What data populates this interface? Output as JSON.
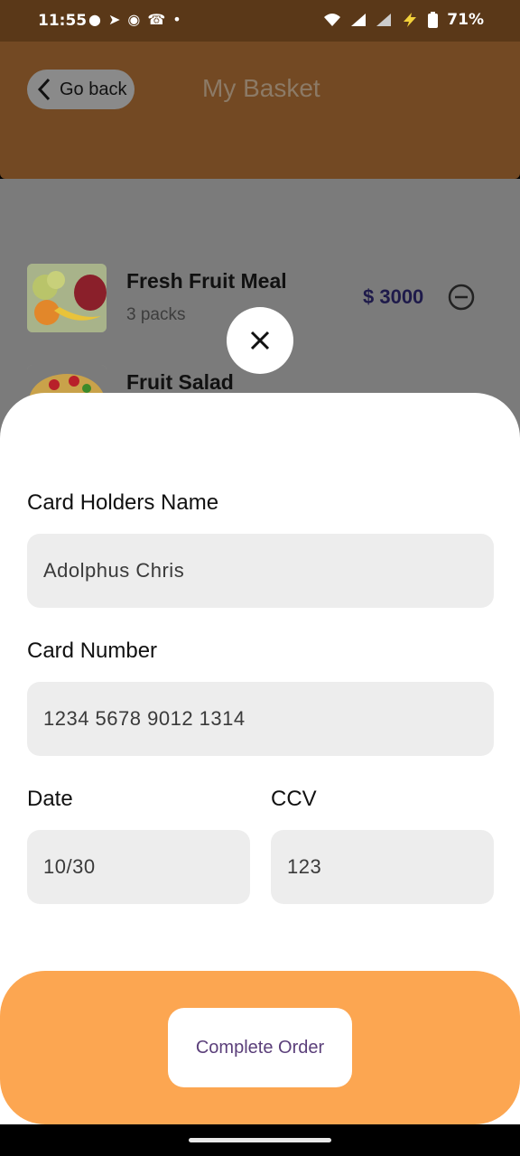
{
  "status_bar": {
    "time": "11:55",
    "battery_percent": "71%",
    "left_icons": [
      "message-icon",
      "telegram-icon",
      "discord-icon",
      "missed-call-icon",
      "dot-icon"
    ],
    "right_icons": [
      "wifi-icon",
      "signal-icon",
      "signal-icon",
      "charging-icon",
      "battery-icon"
    ]
  },
  "header": {
    "back_label": "Go back",
    "title": "My Basket"
  },
  "basket": {
    "items": [
      {
        "name": "Fresh Fruit Meal",
        "qty": "3 packs",
        "price": "$ 3000"
      },
      {
        "name": "Fruit Salad",
        "qty": "",
        "price": ""
      }
    ]
  },
  "form": {
    "card_holder_label": "Card Holders Name",
    "card_holder_value": "Adolphus Chris",
    "card_number_label": "Card Number",
    "card_number_value": "1234 5678 9012 1314",
    "date_label": "Date",
    "date_value": "10/30",
    "ccv_label": "CCV",
    "ccv_value": "123"
  },
  "footer": {
    "complete_label": "Complete Order"
  },
  "colors": {
    "header_bg": "#734923",
    "overlay_bg": "#7b7b7b",
    "footer_bg": "#fca651",
    "input_bg": "#ededed",
    "button_text": "#5b3f7a"
  }
}
